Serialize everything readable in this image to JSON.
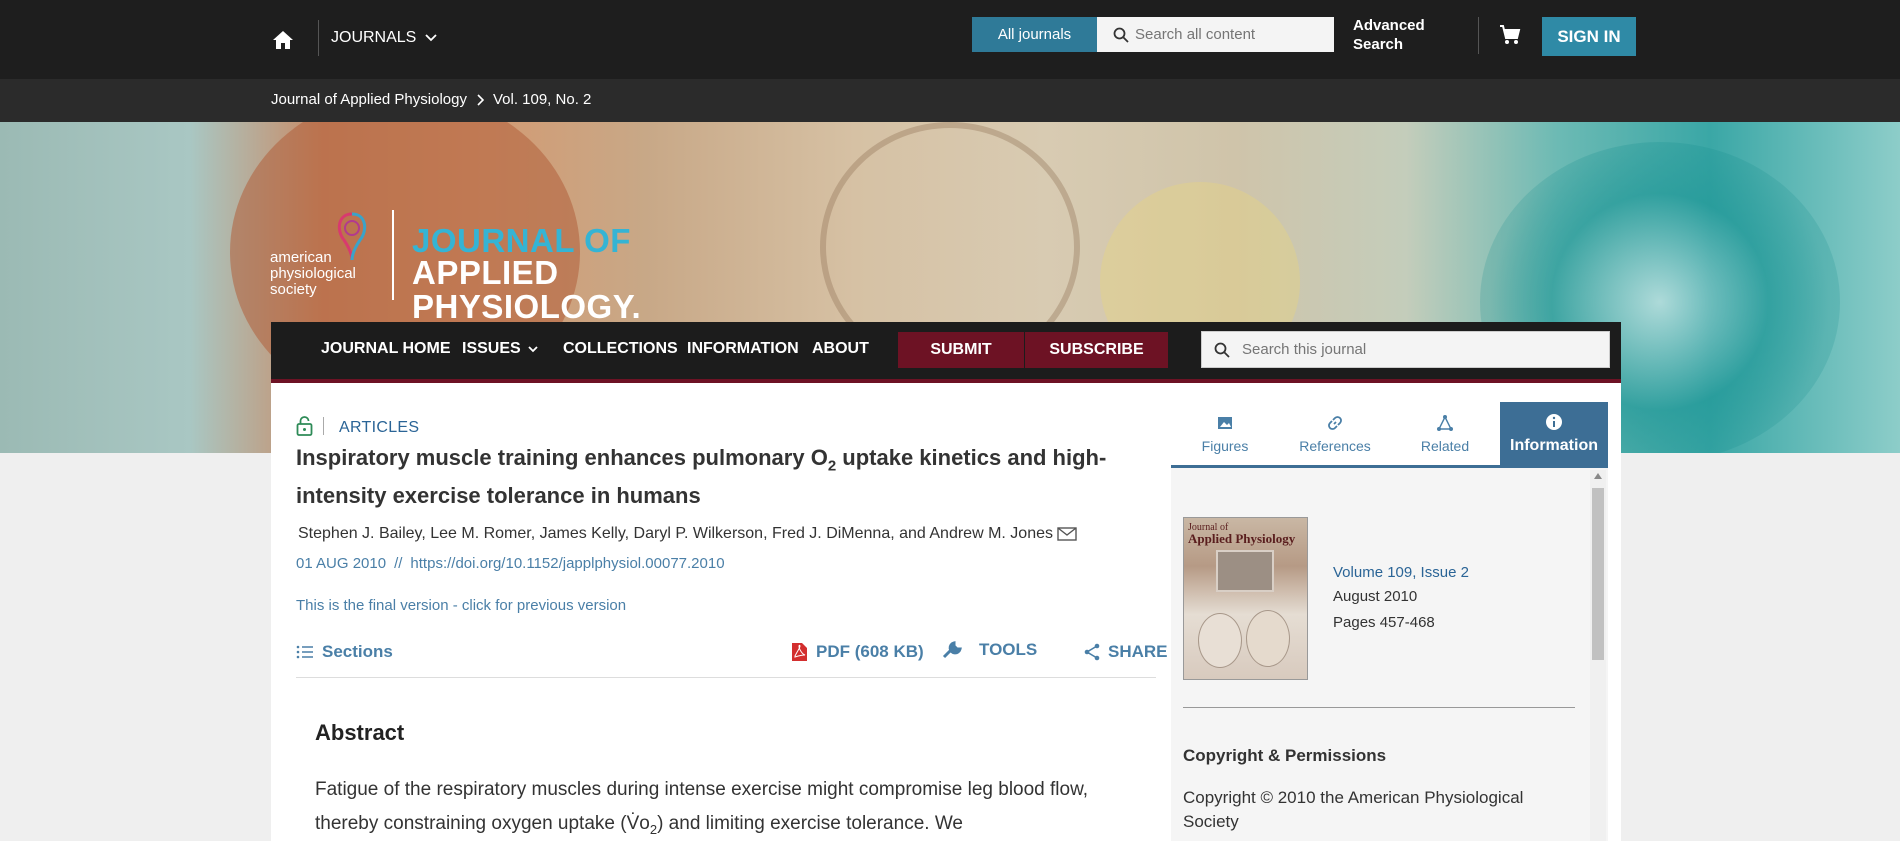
{
  "topbar": {
    "journals_label": "JOURNALS",
    "all_journals_label": "All journals",
    "search_placeholder": "Search all content",
    "advanced_search_label": "Advanced Search",
    "signin_label": "SIGN IN"
  },
  "breadcrumb": {
    "journal": "Journal of Applied Physiology",
    "issue": "Vol. 109, No. 2"
  },
  "hero": {
    "society_name": "american physiological society",
    "journal_title_line1": "JOURNAL OF",
    "journal_title_line2": "APPLIED PHYSIOLOGY."
  },
  "journal_nav": {
    "items": [
      "JOURNAL HOME",
      "ISSUES",
      "COLLECTIONS",
      "INFORMATION",
      "ABOUT"
    ],
    "submit_label": "SUBMIT",
    "subscribe_label": "SUBSCRIBE",
    "search_placeholder": "Search this journal"
  },
  "article": {
    "category": "ARTICLES",
    "title_part1": "Inspiratory muscle training enhances pulmonary O",
    "title_sub": "2",
    "title_part2": " uptake kinetics and high-intensity exercise tolerance in humans",
    "authors": "Stephen J. Bailey, Lee M. Romer, James Kelly, Daryl P. Wilkerson, Fred J. DiMenna, and Andrew M. Jones",
    "date": "01 AUG 2010",
    "separator": "//",
    "doi": "https://doi.org/10.1152/japplphysiol.00077.2010",
    "version_note": "This is the final version - click for previous version",
    "sections_label": "Sections",
    "pdf_label": "PDF (608 KB)",
    "tools_label": "TOOLS",
    "share_label": "SHARE",
    "abstract_heading": "Abstract",
    "abstract_text_1": "Fatigue of the respiratory muscles during intense exercise might compromise leg blood flow, thereby constraining oxygen uptake (",
    "abstract_vo2": "V̇o",
    "abstract_vo2_sub": "2",
    "abstract_text_2": ") and limiting exercise tolerance. We"
  },
  "side_panel": {
    "tabs": [
      "Figures",
      "References",
      "Related",
      "Information"
    ],
    "active_tab": "Information",
    "cover_title_small": "Journal of",
    "cover_title_big": "Applied Physiology",
    "volume": "Volume 109, Issue 2",
    "issue_date": "August 2010",
    "pages": "Pages 457-468",
    "copyright_heading": "Copyright & Permissions",
    "copyright_text": "Copyright © 2010 the American Physiological Society"
  },
  "colors": {
    "topbar_bg": "#1e1e1e",
    "accent_teal": "#2f7a98",
    "nav_red": "#6d1224",
    "link_blue": "#4a7fa7",
    "active_tab_bg": "#3d6e95"
  }
}
